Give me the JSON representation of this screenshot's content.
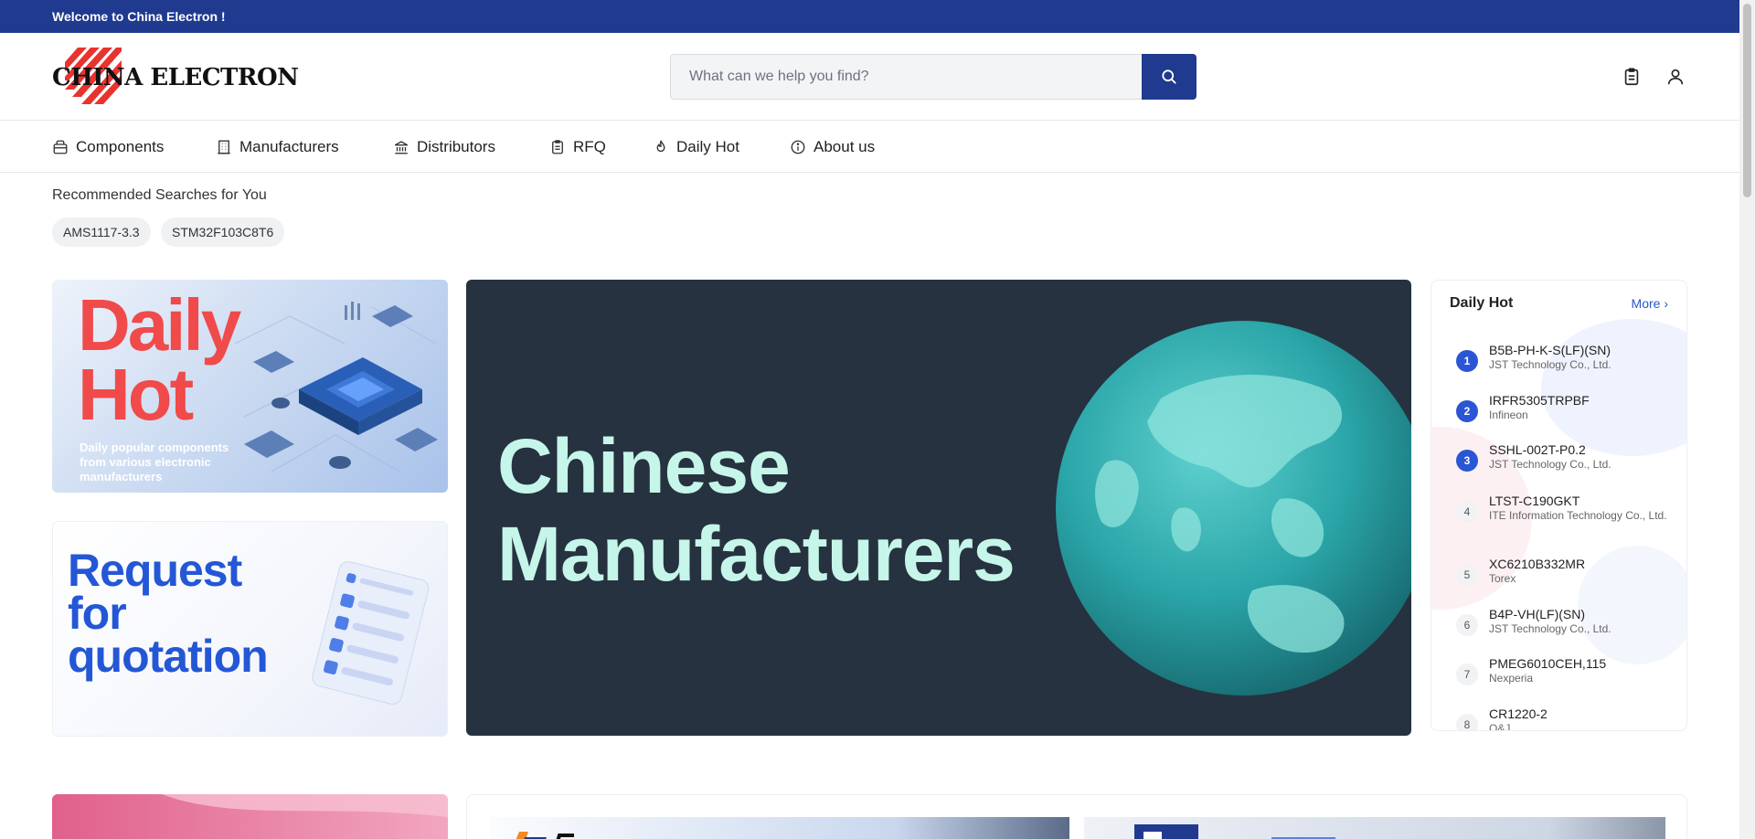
{
  "topbar": {
    "welcome": "Welcome to China Electron !"
  },
  "header": {
    "logo_text": "CHINA ELECTRON",
    "search_placeholder": "What can we help you find?"
  },
  "nav": {
    "items": [
      {
        "label": "Components",
        "icon": "box-icon"
      },
      {
        "label": "Manufacturers",
        "icon": "building-icon"
      },
      {
        "label": "Distributors",
        "icon": "bank-icon"
      },
      {
        "label": "RFQ",
        "icon": "clipboard-icon"
      },
      {
        "label": "Daily Hot",
        "icon": "flame-icon"
      },
      {
        "label": "About us",
        "icon": "info-icon"
      }
    ]
  },
  "recommended": {
    "title": "Recommended Searches for You",
    "chips": [
      "AMS1117-3.3",
      "STM32F103C8T6"
    ]
  },
  "banners": {
    "daily": {
      "line1": "Daily",
      "line2": "Hot",
      "subtitle": "Daily popular components from various electronic manufacturers"
    },
    "rfq": {
      "line1": "Request",
      "line2": "for",
      "line3": "quotation"
    },
    "main": {
      "line1": "Chinese",
      "line2": "Manufacturers"
    }
  },
  "daily_hot": {
    "title": "Daily Hot",
    "more": "More ›",
    "items": [
      {
        "rank": "1",
        "part": "B5B-PH-K-S(LF)(SN)",
        "manufacturer": "JST Technology Co., Ltd."
      },
      {
        "rank": "2",
        "part": "IRFR5305TRPBF",
        "manufacturer": "Infineon"
      },
      {
        "rank": "3",
        "part": "SSHL-002T-P0.2",
        "manufacturer": "JST Technology Co., Ltd."
      },
      {
        "rank": "4",
        "part": "LTST-C190GKT",
        "manufacturer": "ITE Information Technology Co., Ltd."
      },
      {
        "rank": "5",
        "part": "XC6210B332MR",
        "manufacturer": "Torex"
      },
      {
        "rank": "6",
        "part": "B4P-VH(LF)(SN)",
        "manufacturer": "JST Technology Co., Ltd."
      },
      {
        "rank": "7",
        "part": "PMEG6010CEH,115",
        "manufacturer": "Nexperia"
      },
      {
        "rank": "8",
        "part": "CR1220-2",
        "manufacturer": "O&J"
      }
    ]
  },
  "colors": {
    "brand": "#1f3a8f",
    "accent": "#2a56d6",
    "daily_red": "#f04a4a",
    "globe_teal": "#2aa5a8"
  }
}
